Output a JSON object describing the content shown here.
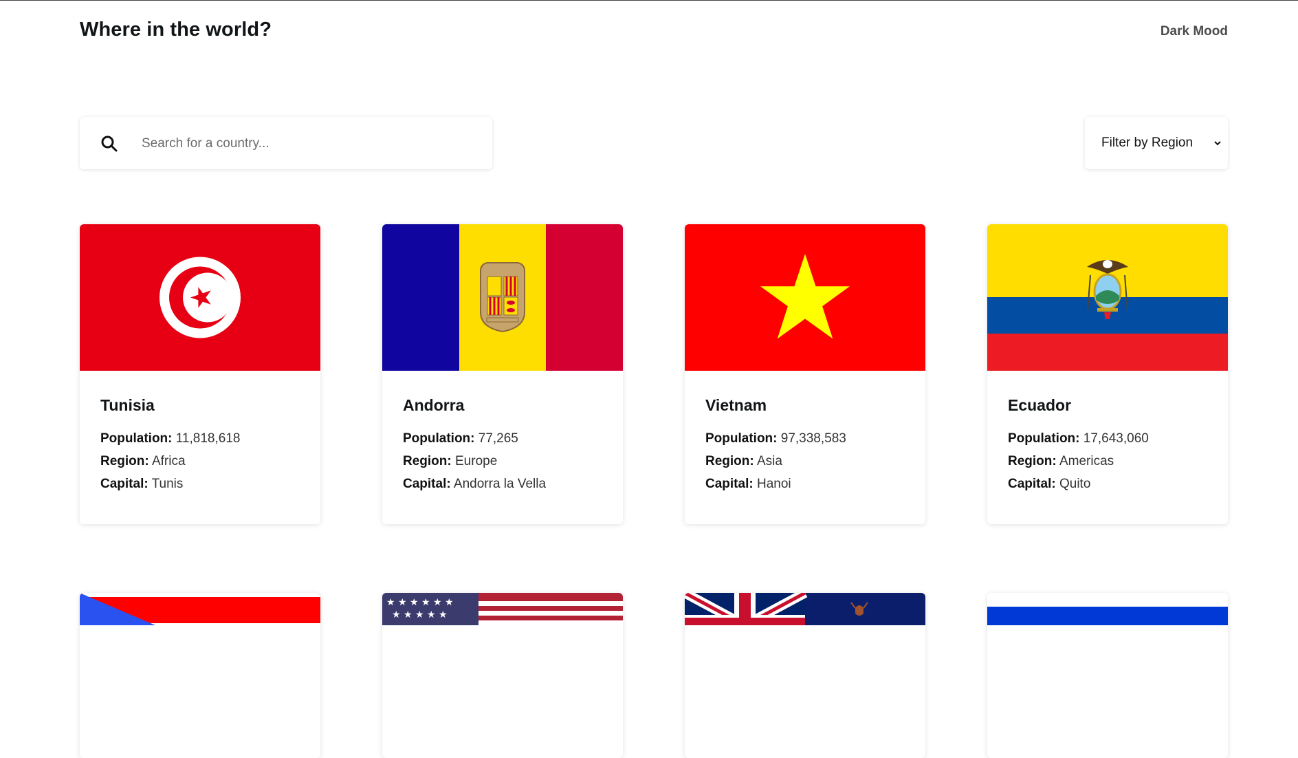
{
  "header": {
    "title": "Where in the world?",
    "theme_toggle": "Dark Mood"
  },
  "search": {
    "placeholder": "Search for a country...",
    "value": "",
    "icon": "search-icon"
  },
  "filter": {
    "label": "Filter by Region",
    "icon": "chevron-down-icon"
  },
  "labels": {
    "population": "Population:",
    "region": "Region:",
    "capital": "Capital:"
  },
  "countries": [
    {
      "name": "Tunisia",
      "population": "11,818,618",
      "region": "Africa",
      "capital": "Tunis"
    },
    {
      "name": "Andorra",
      "population": "77,265",
      "region": "Europe",
      "capital": "Andorra la Vella"
    },
    {
      "name": "Vietnam",
      "population": "97,338,583",
      "region": "Asia",
      "capital": "Hanoi"
    },
    {
      "name": "Ecuador",
      "population": "17,643,060",
      "region": "Americas",
      "capital": "Quito"
    }
  ],
  "colors": {
    "background": "#ffffff",
    "text": "#111517",
    "tunisia_red": "#e70013",
    "andorra_blue": "#10069f",
    "andorra_yellow": "#fedd00",
    "andorra_red": "#d50032",
    "vietnam_red": "#ff0000",
    "vietnam_star": "#ffff00",
    "ecuador_yellow": "#ffdd00",
    "ecuador_blue": "#034ea2",
    "ecuador_red": "#ed1c24"
  }
}
